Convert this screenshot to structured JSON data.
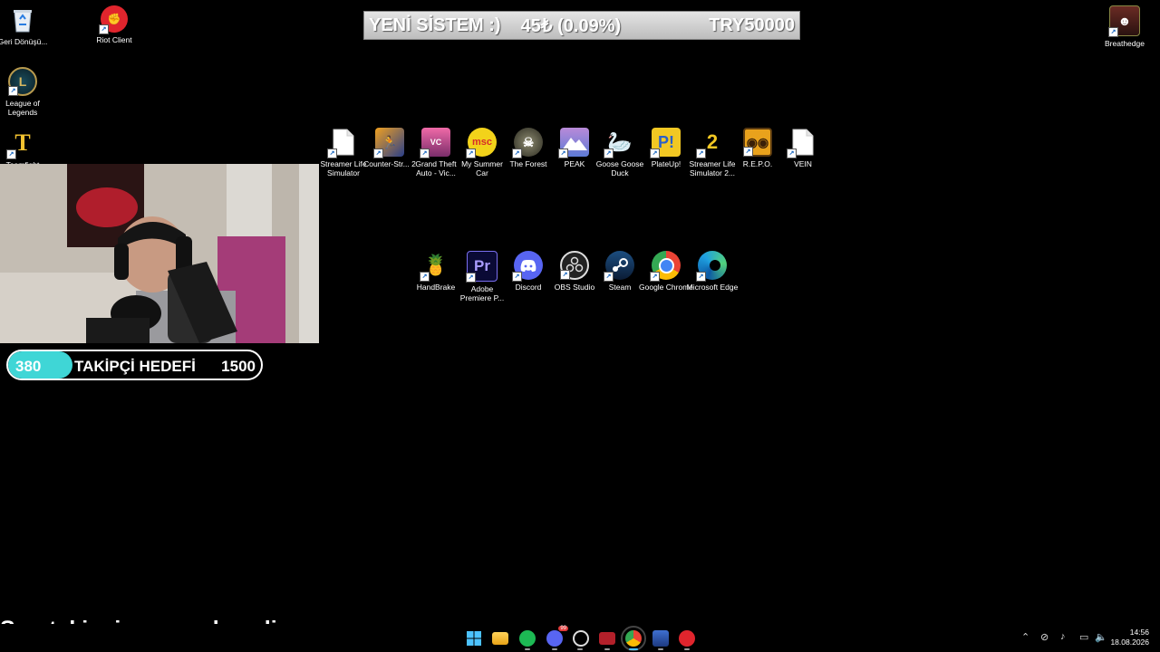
{
  "desktop": {
    "left_icons": [
      {
        "label": "Geri Dönüşü...",
        "icon": "recycle-bin-icon"
      },
      {
        "label": "League of Legends",
        "icon": "league-of-legends-icon"
      },
      {
        "label": "Teamfight",
        "icon": "teamfight-tactics-icon"
      }
    ],
    "riot_client": {
      "label": "Riot Client",
      "icon": "riot-client-icon"
    },
    "breathedge": {
      "label": "Breathedge",
      "icon": "breathedge-icon"
    },
    "row1": [
      {
        "label": "Streamer Life Simulator",
        "icon": "blank-file-icon"
      },
      {
        "label": "Counter-Str... 2",
        "icon": "counter-strike-icon"
      },
      {
        "label": "Grand Theft Auto - Vic...",
        "icon": "gta-vice-city-icon"
      },
      {
        "label": "My Summer Car",
        "icon": "my-summer-car-icon"
      },
      {
        "label": "The Forest",
        "icon": "the-forest-icon"
      },
      {
        "label": "PEAK",
        "icon": "peak-icon"
      },
      {
        "label": "Goose Goose Duck",
        "icon": "goose-goose-duck-icon"
      },
      {
        "label": "PlateUp!",
        "icon": "plateup-icon"
      },
      {
        "label": "Streamer Life Simulator 2...",
        "icon": "streamer-life-2-icon"
      },
      {
        "label": "R.E.P.O.",
        "icon": "repo-icon"
      },
      {
        "label": "VEIN",
        "icon": "blank-file-icon"
      }
    ],
    "row2": [
      {
        "label": "HandBrake",
        "icon": "handbrake-icon"
      },
      {
        "label": "Adobe Premiere P...",
        "icon": "premiere-pro-icon"
      },
      {
        "label": "Discord",
        "icon": "discord-icon"
      },
      {
        "label": "OBS Studio",
        "icon": "obs-studio-icon"
      },
      {
        "label": "Steam",
        "icon": "steam-icon"
      },
      {
        "label": "Google Chrome",
        "icon": "chrome-icon"
      },
      {
        "label": "Microsoft Edge",
        "icon": "edge-icon"
      }
    ]
  },
  "overlay": {
    "donation": {
      "label": "YENİ SİSTEM :)",
      "amount": "45₺ (0.09%)",
      "goal": "TRY50000"
    },
    "follow_goal": {
      "current": "380",
      "label": "TAKİPÇİ HEDEFİ",
      "target": "1500",
      "progress": 0.253
    },
    "last_follower": "Son takipçi: yapyapkanalim"
  },
  "taskbar": {
    "pinned": [
      "start-icon",
      "file-explorer-icon",
      "spotify-icon",
      "discord-icon",
      "obs-icon",
      "app-icon",
      "chrome-icon",
      "app2-icon",
      "riot-icon"
    ],
    "discord_badge": "99",
    "time": "14:56",
    "date": "18.08.2026"
  },
  "colors": {
    "accent_cyan": "#3fd6d6",
    "banner_bg": "#cfcfcf"
  }
}
